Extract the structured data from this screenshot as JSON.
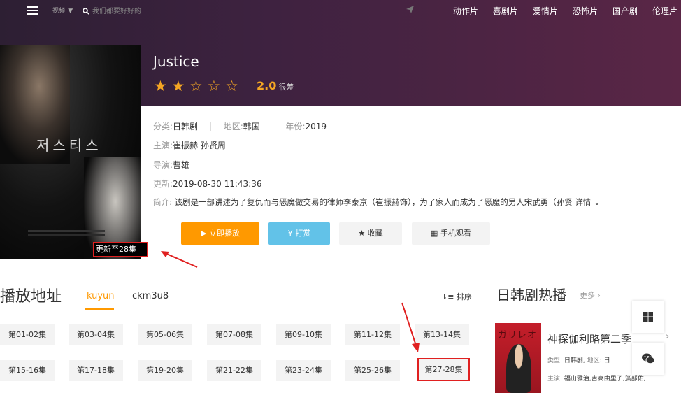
{
  "topbar": {
    "nav_label": "视频",
    "nav_caret": "▼",
    "search_placeholder": "我们都要好好的",
    "categories": [
      "动作片",
      "喜剧片",
      "爱情片",
      "恐怖片",
      "国产剧",
      "伦理片"
    ]
  },
  "poster": {
    "korean_title": "저스티스",
    "update_badge": "更新至28集"
  },
  "detail": {
    "title": "Justice",
    "stars": [
      "★",
      "★",
      "☆",
      "☆",
      "☆"
    ],
    "score": "2.0",
    "rating_text": "很差",
    "category_label": "分类:",
    "category_value": "日韩剧",
    "region_label": "地区:",
    "region_value": "韩国",
    "year_label": "年份:",
    "year_value": "2019",
    "cast_label": "主演:",
    "cast_value": "崔振赫 孙贤周",
    "director_label": "导演:",
    "director_value": "曹雄",
    "updated_label": "更新:",
    "updated_value": "2019-08-30 11:43:36",
    "synopsis_label": "简介:",
    "synopsis_value": "该剧是一部讲述为了复仇而与恶魔做交易的律师李泰京（崔振赫饰），为了家人而成为了恶魔的男人宋武勇（孙贤",
    "more_label": "详情"
  },
  "actions": {
    "play": "▶ 立即播放",
    "tip": "¥ 打赏",
    "favorite": "★ 收藏",
    "mobile": "手机观看"
  },
  "playlist": {
    "title": "播放地址",
    "tabs": [
      "kuyun",
      "ckm3u8"
    ],
    "sort_label": "排序",
    "episodes": [
      "第01-02集",
      "第03-04集",
      "第05-06集",
      "第07-08集",
      "第09-10集",
      "第11-12集",
      "第13-14集",
      "第15-16集",
      "第17-18集",
      "第19-20集",
      "第21-22集",
      "第23-24集",
      "第25-26集",
      "第27-28集"
    ]
  },
  "sidebar": {
    "title": "日韩剧热播",
    "more": "更多",
    "item_title": "神探伽利略第二季",
    "poster_text": "ガリレオ",
    "type_label": "类型:",
    "type_value": "日韩剧,",
    "region_label": "地区:",
    "region_value": "日",
    "cast_label": "主演:",
    "cast_value": "福山雅治,吉高由里子,藻部佑,"
  },
  "colors": {
    "accent": "#ff9900",
    "tip": "#62c2e8",
    "highlight": "#e02020"
  }
}
